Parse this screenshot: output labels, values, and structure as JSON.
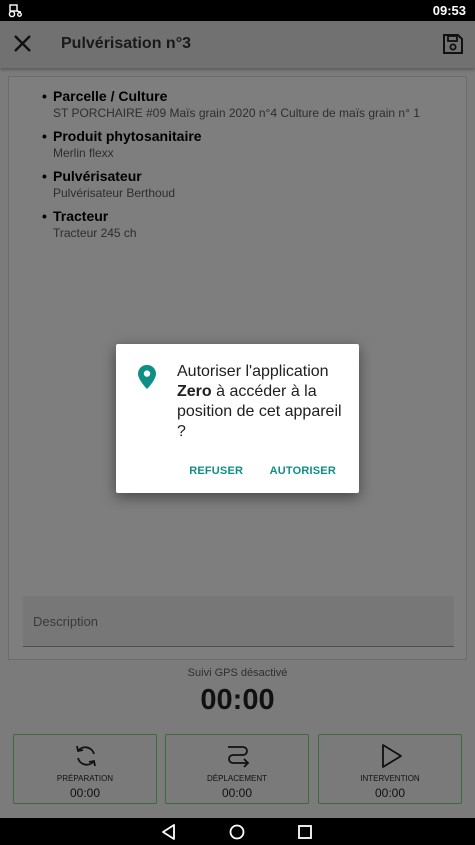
{
  "status_bar": {
    "time": "09:53",
    "app_icon": "tractor-icon"
  },
  "app_bar": {
    "title": "Pulvérisation n°3",
    "close_icon": "close-icon",
    "save_icon": "save-icon"
  },
  "info": {
    "items": [
      {
        "label": "Parcelle / Culture",
        "value": "ST PORCHAIRE #09 Maïs grain 2020 n°4 Culture de maïs grain n° 1"
      },
      {
        "label": "Produit phytosanitaire",
        "value": "Merlin flexx"
      },
      {
        "label": "Pulvérisateur",
        "value": "Pulvérisateur Berthoud"
      },
      {
        "label": "Tracteur",
        "value": "Tracteur 245 ch"
      }
    ]
  },
  "description": {
    "placeholder": "Description",
    "value": ""
  },
  "gps": {
    "status": "Suivi GPS désactivé"
  },
  "timer": {
    "value": "00:00"
  },
  "actions": [
    {
      "label": "PRÉPARATION",
      "time": "00:00",
      "icon": "refresh-icon"
    },
    {
      "label": "DÉPLACEMENT",
      "time": "00:00",
      "icon": "route-icon"
    },
    {
      "label": "INTERVENTION",
      "time": "00:00",
      "icon": "play-icon"
    }
  ],
  "dialog": {
    "icon": "location-pin-icon",
    "text_before": "Autoriser l'application ",
    "app_name": "Zero",
    "text_after": " à accéder à la position de cet appareil ?",
    "deny_label": "REFUSER",
    "allow_label": "AUTORISER",
    "accent_color": "#0e8f86"
  },
  "nav_bar": {
    "back": "back-icon",
    "home": "home-icon",
    "recents": "recents-icon"
  }
}
